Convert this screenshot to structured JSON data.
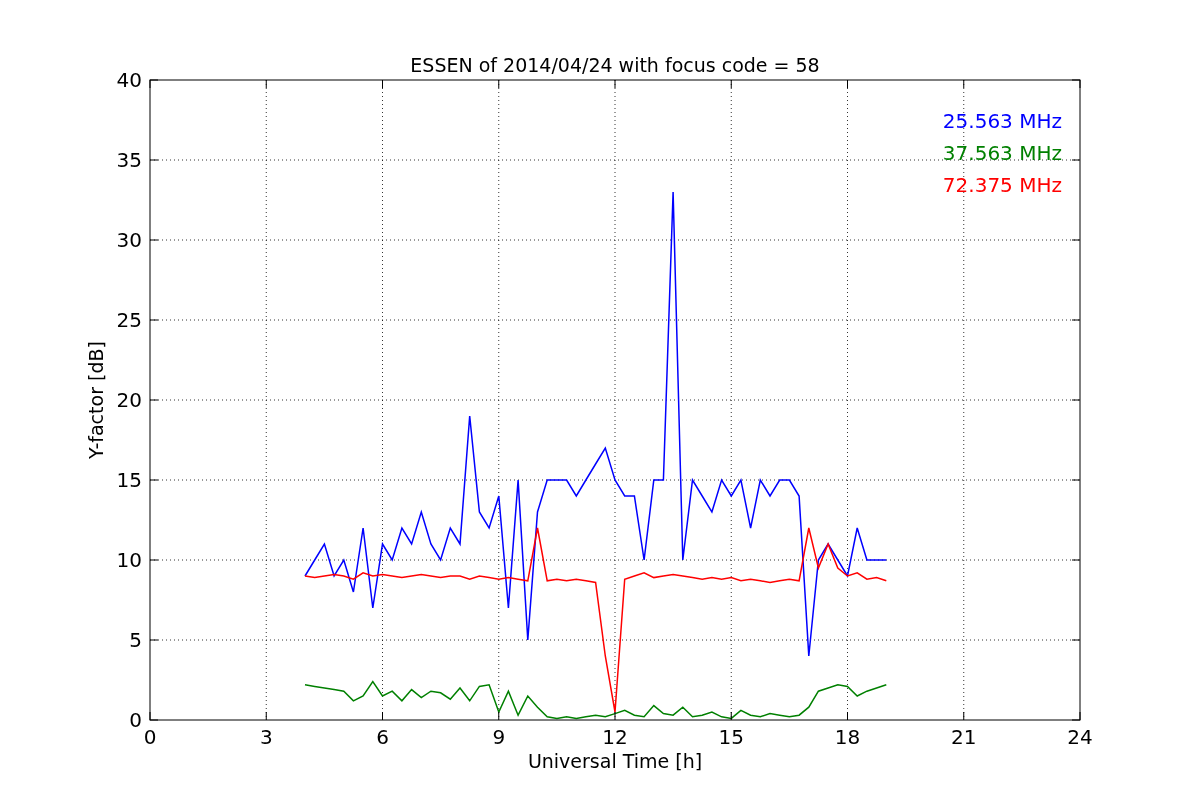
{
  "chart_data": {
    "type": "line",
    "title": "ESSEN of 2014/04/24 with focus code = 58",
    "xlabel": "Universal Time [h]",
    "ylabel": "Y-factor [dB]",
    "x": [
      4,
      4.25,
      4.5,
      4.75,
      5,
      5.25,
      5.5,
      5.75,
      6,
      6.25,
      6.5,
      6.75,
      7,
      7.25,
      7.5,
      7.75,
      8,
      8.25,
      8.5,
      8.75,
      9,
      9.25,
      9.5,
      9.75,
      10,
      10.25,
      10.5,
      10.75,
      11,
      11.25,
      11.5,
      11.75,
      12,
      12.25,
      12.5,
      12.75,
      13,
      13.25,
      13.5,
      13.75,
      14,
      14.25,
      14.5,
      14.75,
      15,
      15.25,
      15.5,
      15.75,
      16,
      16.25,
      16.5,
      16.75,
      17,
      17.25,
      17.5,
      17.75,
      18,
      18.25,
      18.5,
      18.75,
      19
    ],
    "series": [
      {
        "name": "25.563 MHz",
        "color": "#0000ff",
        "values": [
          9,
          10,
          11,
          9,
          10,
          8,
          12,
          7,
          11,
          10,
          12,
          11,
          13,
          11,
          10,
          12,
          11,
          19,
          13,
          12,
          14,
          7,
          15,
          5,
          13,
          15,
          15,
          15,
          14,
          15,
          16,
          17,
          15,
          14,
          14,
          10,
          15,
          15,
          33,
          10,
          15,
          14,
          13,
          15,
          14,
          15,
          12,
          15,
          14,
          15,
          15,
          14,
          4,
          10,
          11,
          10,
          9,
          12,
          10,
          10,
          10
        ]
      },
      {
        "name": "37.563 MHz",
        "color": "#008000",
        "values": [
          2.2,
          2.1,
          2.0,
          1.9,
          1.8,
          1.2,
          1.5,
          2.4,
          1.5,
          1.8,
          1.2,
          1.9,
          1.4,
          1.8,
          1.7,
          1.3,
          2.0,
          1.2,
          2.1,
          2.2,
          0.5,
          1.8,
          0.3,
          1.5,
          0.8,
          0.2,
          0.1,
          0.2,
          0.1,
          0.2,
          0.3,
          0.2,
          0.4,
          0.6,
          0.3,
          0.2,
          0.9,
          0.4,
          0.3,
          0.8,
          0.2,
          0.3,
          0.5,
          0.2,
          0.1,
          0.6,
          0.3,
          0.2,
          0.4,
          0.3,
          0.2,
          0.3,
          0.8,
          1.8,
          2.0,
          2.2,
          2.1,
          1.5,
          1.8,
          2.0,
          2.2
        ]
      },
      {
        "name": "72.375 MHz",
        "color": "#ff0000",
        "values": [
          9,
          8.9,
          9,
          9.1,
          9,
          8.8,
          9.2,
          9,
          9.1,
          9,
          8.9,
          9,
          9.1,
          9,
          8.9,
          9,
          9,
          8.8,
          9,
          8.9,
          8.8,
          8.9,
          8.8,
          8.7,
          12,
          8.7,
          8.8,
          8.7,
          8.8,
          8.7,
          8.6,
          4,
          0.5,
          8.8,
          9,
          9.2,
          8.9,
          9,
          9.1,
          9,
          8.9,
          8.8,
          8.9,
          8.8,
          8.9,
          8.7,
          8.8,
          8.7,
          8.6,
          8.7,
          8.8,
          8.7,
          12,
          9.5,
          11,
          9.5,
          9,
          9.2,
          8.8,
          8.9,
          8.7
        ]
      }
    ],
    "grid": true,
    "xlim": [
      0,
      24
    ],
    "ylim": [
      0,
      40
    ],
    "xticks": [
      0,
      3,
      6,
      9,
      12,
      15,
      18,
      21,
      24
    ],
    "yticks": [
      0,
      5,
      10,
      15,
      20,
      25,
      30,
      35,
      40
    ]
  }
}
